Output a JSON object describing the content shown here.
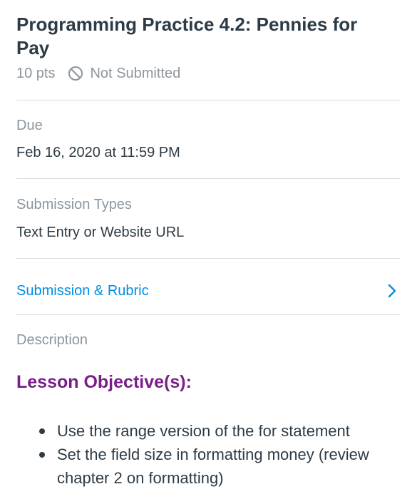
{
  "assignment": {
    "title": "Programming Practice 4.2: Pennies for Pay",
    "points": "10 pts",
    "status": "Not Submitted"
  },
  "due": {
    "label": "Due",
    "value": "Feb 16, 2020 at 11:59 PM"
  },
  "submission_types": {
    "label": "Submission Types",
    "value": "Text Entry or Website URL"
  },
  "submission_link": {
    "label": "Submission & Rubric"
  },
  "description": {
    "label": "Description",
    "heading": "Lesson Objective(s):",
    "objectives": [
      "Use the range version of the for statement",
      "Set the field size in formatting money (review chapter 2 on formatting)"
    ]
  },
  "colors": {
    "link": "#008ee2",
    "heading": "#7a1f8a",
    "muted": "#8b969e",
    "text": "#2d3b45"
  },
  "icons": {
    "status": "not-submitted-icon",
    "link": "chevron-right-icon"
  }
}
